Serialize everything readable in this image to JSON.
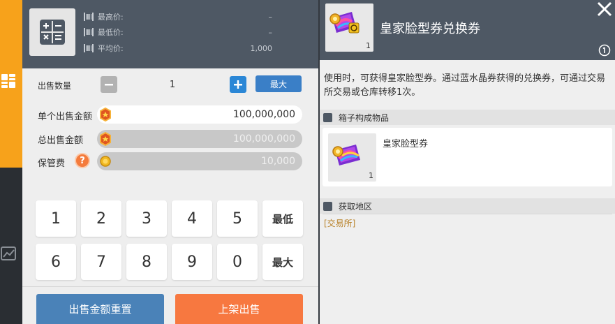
{
  "colors": {
    "accent_orange": "#f7a21b",
    "header_slate": "#4e5864",
    "button_blue": "#3a7fc7",
    "reset_blue": "#4a82b8",
    "list_orange": "#f77840",
    "link_gold": "#b8822a"
  },
  "sidebar": {
    "icons": [
      "grid-icon",
      "chart-icon"
    ]
  },
  "sell": {
    "prices": {
      "highest_label": "最高价:",
      "highest_value": "–",
      "lowest_label": "最低价:",
      "lowest_value": "–",
      "average_label": "平均价:",
      "average_value": "1,000"
    },
    "quantity": {
      "label": "出售数量",
      "value": "1",
      "max_label": "最大"
    },
    "unit_price": {
      "label": "单个出售金额",
      "value": "100,000,000"
    },
    "total_price": {
      "label": "总出售金额",
      "value": "100,000,000"
    },
    "fee": {
      "label": "保管费",
      "help": "?",
      "value": "10,000"
    },
    "keypad": {
      "keys": [
        "1",
        "2",
        "3",
        "4",
        "5",
        "最低",
        "6",
        "7",
        "8",
        "9",
        "0",
        "最大"
      ]
    },
    "reset_label": "出售金额重置",
    "list_label": "上架出售"
  },
  "detail": {
    "title": "皇家脸型券兑换券",
    "item_count": "1",
    "description": "使用时，可获得皇家脸型券。通过蓝水晶券获得的兑换券，可通过交易所交易或仓库转移1次。",
    "contents_header": "箱子构成物品",
    "contents_item_name": "皇家脸型券",
    "contents_item_count": "1",
    "obtain_header": "获取地区",
    "obtain_link": "[交易所]"
  }
}
